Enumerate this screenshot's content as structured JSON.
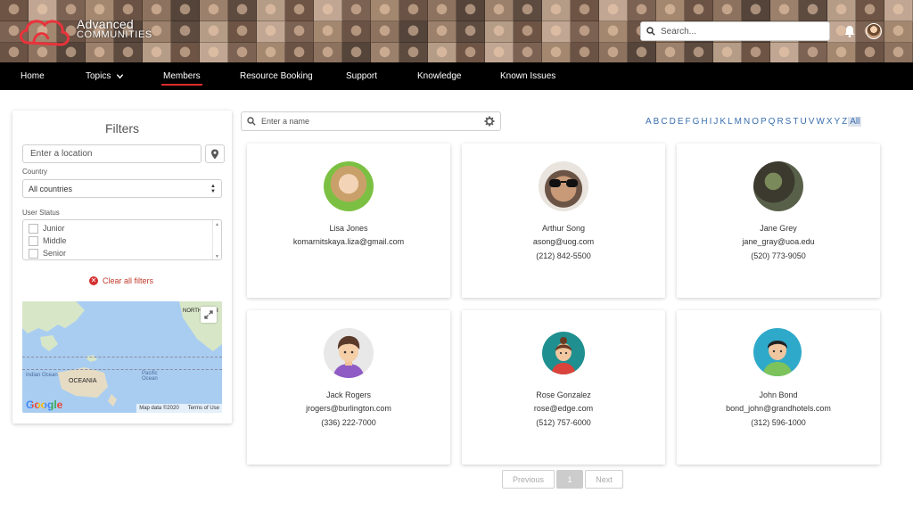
{
  "header": {
    "logo_line1": "Advanced",
    "logo_line2": "COMMUNITIES",
    "search_placeholder": "Search..."
  },
  "nav": {
    "items": [
      {
        "label": "Home"
      },
      {
        "label": "Topics"
      },
      {
        "label": "Members"
      },
      {
        "label": "Resource Booking"
      },
      {
        "label": "Support"
      },
      {
        "label": "Knowledge"
      },
      {
        "label": "Known Issues"
      }
    ],
    "active": "Members"
  },
  "filters": {
    "title": "Filters",
    "location_placeholder": "Enter a location",
    "country_label": "Country",
    "country_value": "All countries",
    "status_label": "User Status",
    "statuses": [
      "Junior",
      "Middle",
      "Senior"
    ],
    "clear_label": "Clear all filters",
    "map": {
      "label_north_america": "NORTH AMER",
      "label_oceania": "OCEANIA",
      "label_indian_ocean": "Indian Ocean",
      "label_pacific_ocean": "Pacific Ocean",
      "google": "Google",
      "map_data": "Map data ©2020",
      "terms": "Terms of Use"
    }
  },
  "members": {
    "search_placeholder": "Enter a name",
    "alphabet": [
      "A",
      "B",
      "C",
      "D",
      "E",
      "F",
      "G",
      "H",
      "I",
      "J",
      "K",
      "L",
      "M",
      "N",
      "O",
      "P",
      "Q",
      "R",
      "S",
      "T",
      "U",
      "V",
      "W",
      "X",
      "Y",
      "Z",
      "All"
    ],
    "alphabet_selected": "All",
    "cards": [
      {
        "name": "Lisa Jones",
        "email": "komarnitskaya.liza@gmail.com",
        "phone": ""
      },
      {
        "name": "Arthur Song",
        "email": "asong@uog.com",
        "phone": "(212) 842-5500"
      },
      {
        "name": "Jane Grey",
        "email": "jane_gray@uoa.edu",
        "phone": "(520) 773-9050"
      },
      {
        "name": "Jack Rogers",
        "email": "jrogers@burlington.com",
        "phone": "(336) 222-7000"
      },
      {
        "name": "Rose Gonzalez",
        "email": "rose@edge.com",
        "phone": "(512) 757-6000"
      },
      {
        "name": "John Bond",
        "email": "bond_john@grandhotels.com",
        "phone": "(312) 596-1000"
      }
    ]
  },
  "pagination": {
    "previous": "Previous",
    "current": "1",
    "next": "Next"
  },
  "colors": {
    "accent_red": "#e02b2b",
    "link_blue": "#3a6fb0",
    "nav_bg": "#000000"
  }
}
